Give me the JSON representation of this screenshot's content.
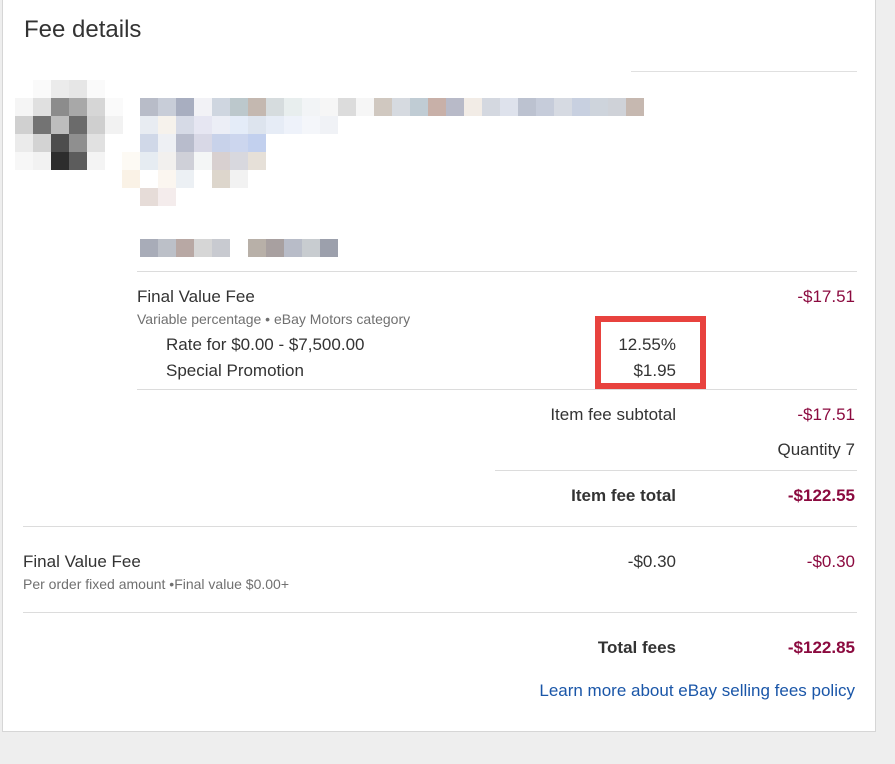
{
  "card": {
    "title": "Fee details"
  },
  "item_fee": {
    "name": "Final Value Fee",
    "description": "Variable percentage • eBay Motors category",
    "amount": "-$17.51",
    "rows": [
      {
        "label": "Rate for $0.00 - $7,500.00",
        "value": "12.55%"
      },
      {
        "label": "Special Promotion",
        "value": "$1.95"
      }
    ],
    "subtotal_label": "Item fee subtotal",
    "subtotal_value": "-$17.51",
    "quantity": "Quantity 7",
    "total_label": "Item fee total",
    "total_value": "-$122.55"
  },
  "order_fee": {
    "name": "Final Value Fee",
    "description": "Per order fixed amount •Final value $0.00+",
    "value": "-$0.30",
    "amount": "-$0.30"
  },
  "totals": {
    "label": "Total fees",
    "value": "-$122.85"
  },
  "links": {
    "policy": "Learn more about eBay selling fees policy"
  },
  "colors": {
    "negative_amount": "#8b0a3f",
    "link": "#1a56a8",
    "highlight_box": "#e8423e"
  },
  "blurred_colors": {
    "thumb": [
      "#ffffff",
      "#fafafa",
      "#ebebeb",
      "#e6e6e6",
      "#fafafa",
      "#ffffff",
      "#f5f5f5",
      "#e0e0e0",
      "#8c8c8c",
      "#a8a8a8",
      "#d6d6d6",
      "#fafafa",
      "#d0d0d0",
      "#737373",
      "#bdbdbd",
      "#6b6b6b",
      "#cfcfcf",
      "#f2f2f2",
      "#ebebeb",
      "#d3d3d3",
      "#4d4d4d",
      "#8f8f8f",
      "#e1e1e1",
      "#ffffff",
      "#f7f7f7",
      "#f2f2f2",
      "#2d2d2d",
      "#5c5c5c",
      "#f4f4f4",
      "#ffffff"
    ],
    "line1": [
      "#b8bcc8",
      "#c8cdd8",
      "#a8aec0",
      "#f2f2f6",
      "#cfd6e0",
      "#bcc8cc",
      "#c4b8b0",
      "#d6dcde",
      "#e8eeee",
      "#f2f4f6",
      "#f6f6f6",
      "#dcdcdc",
      "#f6f6f6",
      "#d0c8c0",
      "#d6dae0",
      "#c0ccd4",
      "#c8b0a8",
      "#b8bac8",
      "#f2ece6",
      "#d4d8e0",
      "#dee2ec",
      "#bcc2d0",
      "#c6ccda",
      "#d6dae2",
      "#c8d0e0",
      "#ced4dc",
      "#cfd2d8",
      "#c6b8b0"
    ],
    "line1b": [
      "#e8ecf2",
      "#f6f2ec",
      "#d6dae6",
      "#e6e6f2",
      "#eceef6",
      "#e4ecf8",
      "#dde4ee",
      "#e6ecf6",
      "#eef2fa",
      "#f4f6fa",
      "#f0f2f6"
    ],
    "line1c": [
      "#d0d8e8",
      "#eef0f4",
      "#b8bccc",
      "#d8d8e6",
      "#c8d2ea",
      "#ccd6ee",
      "#c2d0ee"
    ],
    "line1d": [
      "#fdfaf4",
      "#e6ecf2",
      "#f2f0ee",
      "#cfd0d8",
      "#f4f6f6",
      "#d8d0d0",
      "#d8d8de",
      "#e6e0d8",
      "#ffffff"
    ],
    "line1e": [
      "#faf2e6",
      "#ffffff",
      "#fbf6f0",
      "#ecf0f4",
      "#ffffff",
      "#ddd6cc",
      "#f2f2f2",
      "#ffffff"
    ],
    "line1f": [
      "#ffffff",
      "#e6dcd8",
      "#f4ecec"
    ],
    "line2": [
      "#a8acb8",
      "#bcc0c8",
      "#b8a8a4",
      "#d6d6d6",
      "#c8cad0",
      "#ffffff",
      "#b8b0a8",
      "#a8a0a0",
      "#b8bcc8",
      "#c8ccd0",
      "#9ca0ac",
      "#ffffff"
    ]
  }
}
